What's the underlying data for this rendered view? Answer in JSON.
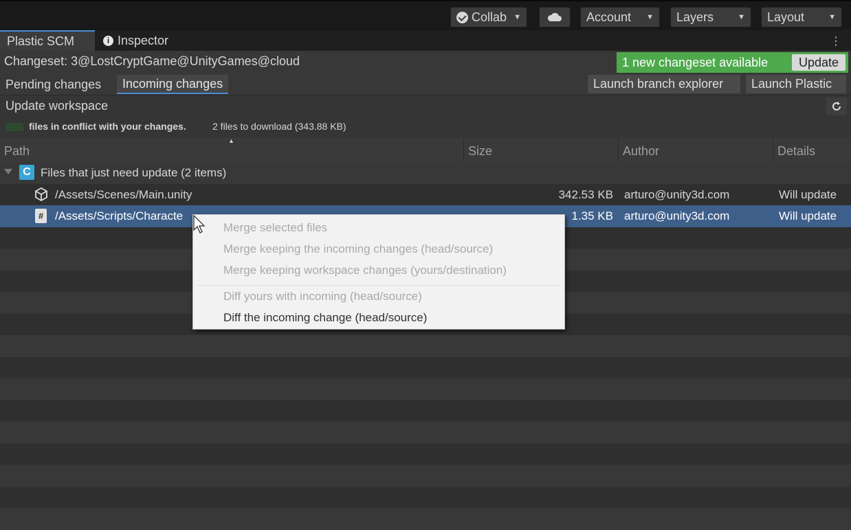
{
  "toolbar": {
    "collab_label": "Collab",
    "account_label": "Account",
    "layers_label": "Layers",
    "layout_label": "Layout"
  },
  "tabs": {
    "plastic": "Plastic SCM",
    "inspector": "Inspector"
  },
  "changeset": {
    "label": "Changeset: 3@LostCryptGame@UnityGames@cloud",
    "notice": "1 new changeset available",
    "update_button": "Update"
  },
  "subtabs": {
    "pending": "Pending changes",
    "incoming": "Incoming changes",
    "branch_explorer": "Launch branch explorer",
    "launch_plastic": "Launch Plastic"
  },
  "workspace": {
    "update_label": "Update workspace",
    "conflict_text": "files in conflict with your changes.",
    "download_text": "2 files to download (343.88 KB)"
  },
  "table": {
    "headers": {
      "path": "Path",
      "size": "Size",
      "author": "Author",
      "details": "Details"
    },
    "group": {
      "badge": "C",
      "label": "Files that just need update (2 items)"
    },
    "rows": [
      {
        "path": "/Assets/Scenes/Main.unity",
        "size": "342.53 KB",
        "author": "arturo@unity3d.com",
        "details": "Will update"
      },
      {
        "path": "/Assets/Scripts/Characte",
        "size": "1.35 KB",
        "author": "arturo@unity3d.com",
        "details": "Will update"
      }
    ]
  },
  "context_menu": {
    "items": [
      "Merge selected files",
      "Merge keeping the incoming changes (head/source)",
      "Merge keeping workspace changes (yours/destination)",
      "Diff yours with incoming (head/source)",
      "Diff the incoming change (head/source)"
    ]
  },
  "colors": {
    "notice_green": "#4ea94c",
    "selection_blue": "#3e5f8a",
    "tab_accent": "#4a8bd1",
    "badge_cyan": "#3aa6d6"
  }
}
